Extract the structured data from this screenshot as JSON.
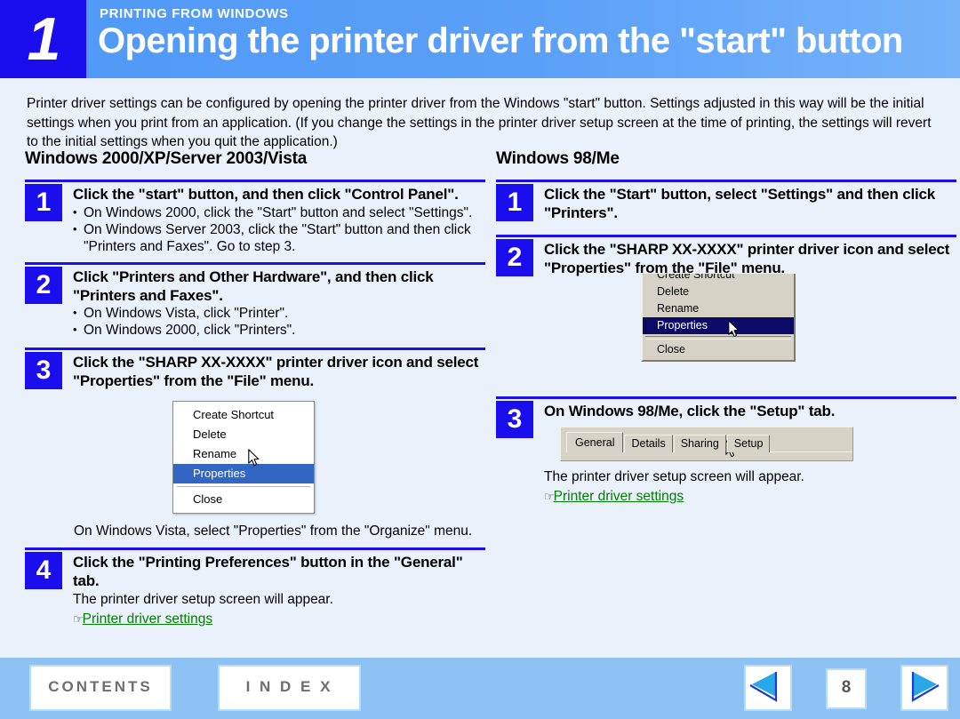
{
  "header": {
    "chapter_number": "1",
    "kicker": "PRINTING FROM WINDOWS",
    "title": "Opening the printer driver from the \"start\" button"
  },
  "intro": "Printer driver settings can be configured by opening the printer driver from the Windows \"start\" button. Settings adjusted in this way will be the initial settings when you print from an application. (If you change the settings in the printer driver setup screen at the time of printing, the settings will revert to the initial settings when you quit the application.)",
  "left_column": {
    "heading": "Windows 2000/XP/Server 2003/Vista",
    "steps": [
      {
        "number": "1",
        "title": "Click the \"start\" button, and then click \"Control Panel\".",
        "bullet1": "On Windows 2000, click the \"Start\" button and select \"Settings\".",
        "bullet2": "On Windows Server 2003, click the \"Start\" button and then click \"Printers and Faxes\". Go to step 3."
      },
      {
        "number": "2",
        "title": "Click \"Printers and Other Hardware\", and then click \"Printers and Faxes\".",
        "bullet1": "On Windows Vista, click \"Printer\".",
        "bullet2": "On Windows 2000, click \"Printers\"."
      },
      {
        "number": "3",
        "title": "Click the \"SHARP XX-XXXX\" printer driver icon and select \"Properties\" from the \"File\" menu."
      },
      {
        "number": "4",
        "title": "Click the \"Printing Preferences\" button in the \"General\" tab.",
        "note": "The printer driver setup screen will appear.",
        "link": "Printer driver settings",
        "link_icon": "pointing-hand-icon"
      }
    ],
    "vista_note": "On Windows Vista, select \"Properties\" from the \"Organize\" menu.",
    "xp_menu": {
      "items": [
        "Create Shortcut",
        "Delete",
        "Rename",
        "Properties",
        "Close"
      ],
      "selected": "Properties",
      "highlight_color": "#3366c3"
    }
  },
  "right_column": {
    "heading": "Windows 98/Me",
    "steps": [
      {
        "number": "1",
        "title": "Click the \"Start\" button, select \"Settings\" and then click \"Printers\"."
      },
      {
        "number": "2",
        "title": "Click the \"SHARP XX-XXXX\" printer driver icon and select \"Properties\" from the \"File\" menu."
      },
      {
        "number": "3",
        "title": "On Windows 98/Me, click the \"Setup\" tab.",
        "note": "The printer driver setup screen will appear.",
        "link": "Printer driver settings",
        "link_icon": "pointing-hand-icon"
      }
    ],
    "w98_menu": {
      "items": [
        "Create Shortcut",
        "Delete",
        "Rename",
        "Properties",
        "Close"
      ],
      "selected": "Properties",
      "highlight_color": "#0a0a66"
    },
    "w98_tabs": {
      "items": [
        "General",
        "Details",
        "Sharing",
        "Setup"
      ],
      "active": "General"
    }
  },
  "footer": {
    "contents_label": "CONTENTS",
    "index_label": "I N D E X",
    "page_number": "8",
    "prev_icon": "triangle-left-icon",
    "next_icon": "triangle-right-icon"
  },
  "colors": {
    "header_blue": "#5aa0f8",
    "badge_blue": "#1a0eee",
    "page_bg": "#eaf1fb",
    "footer_blue": "#8ec2f5",
    "link_green": "#008000"
  }
}
